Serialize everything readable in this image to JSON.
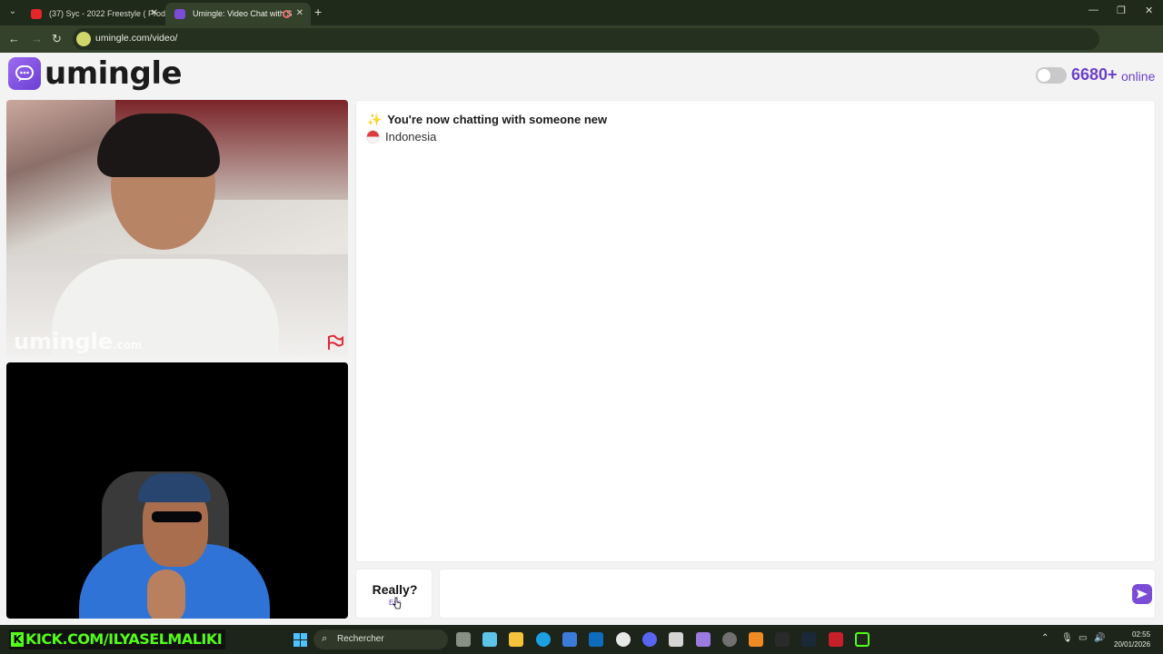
{
  "browser": {
    "tabs": [
      {
        "title": "(37) Syc - 2022 Freestyle ( Prod",
        "active": false
      },
      {
        "title": "Umingle: Video Chat with S",
        "active": true
      }
    ],
    "url": "umingle.com/video/"
  },
  "header": {
    "brand": "umingle",
    "online_count": "6680+",
    "online_label": "online"
  },
  "video": {
    "watermark": "umingle",
    "watermark_suffix": ".com"
  },
  "chat": {
    "system_message": "You're now chatting with someone new",
    "country": "Indonesia",
    "stop_button_label": "Really?",
    "stop_button_sub": "Esc",
    "message_placeholder": ""
  },
  "taskbar": {
    "stream_banner": "KICK.COM/ILYASELMALIKI",
    "search_label": "Rechercher",
    "time": "02:55",
    "date": "20/01/2026"
  },
  "colors": {
    "brand_purple": "#6c42c9",
    "kick_green": "#53fc18",
    "chrome_dark": "#1f2a1a"
  }
}
